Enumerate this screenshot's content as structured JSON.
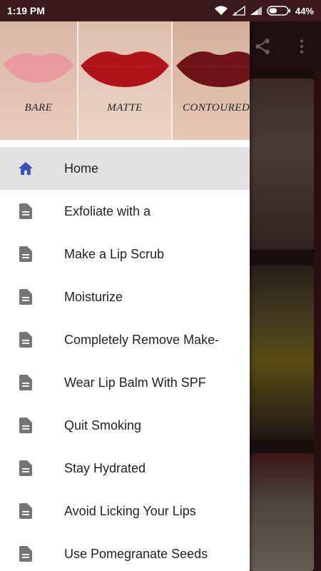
{
  "status_bar": {
    "time": "1:19 PM",
    "battery_percent": "44%",
    "battery_level": 0.44
  },
  "drawer_header": {
    "panels": [
      {
        "label": "BARE",
        "lip_color": "#e89aa0"
      },
      {
        "label": "MATTE",
        "lip_color": "#b0141a"
      },
      {
        "label": "CONTOURED",
        "lip_color": "#6e1419"
      }
    ]
  },
  "menu": {
    "items": [
      {
        "label": "Home",
        "icon": "home-icon",
        "active": true
      },
      {
        "label": "Exfoliate with a",
        "icon": "document-icon"
      },
      {
        "label": "Make a Lip Scrub",
        "icon": "document-icon"
      },
      {
        "label": "Moisturize",
        "icon": "document-icon"
      },
      {
        "label": "Completely Remove Make-",
        "icon": "document-icon"
      },
      {
        "label": "Wear Lip Balm With SPF",
        "icon": "document-icon"
      },
      {
        "label": "Quit Smoking",
        "icon": "document-icon"
      },
      {
        "label": "Stay Hydrated",
        "icon": "document-icon"
      },
      {
        "label": "Avoid Licking Your Lips",
        "icon": "document-icon"
      },
      {
        "label": "Use Pomegranate Seeds",
        "icon": "document-icon"
      }
    ]
  },
  "colors": {
    "home_icon": "#3f51b5",
    "doc_icon": "#757575",
    "active_bg": "#e2e2e2"
  }
}
